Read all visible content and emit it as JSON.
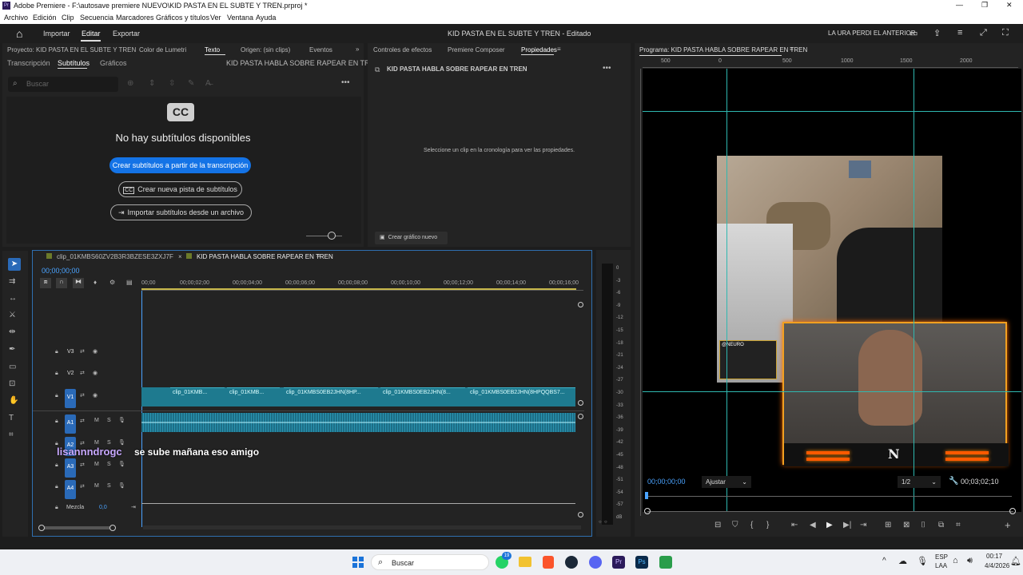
{
  "window": {
    "title": "Adobe Premiere - F:\\autosave premiere NUEVO\\KID PASTA EN EL SUBTE Y TREN.prproj *",
    "minimize": "—",
    "maximize": "❐",
    "close": "✕"
  },
  "menu": [
    "Archivo",
    "Edición",
    "Clip",
    "Secuencia",
    "Marcadores",
    "Gráficos y títulos",
    "Ver",
    "Ventana",
    "Ayuda"
  ],
  "appbar": {
    "home": "⌂",
    "tabs": [
      "Importar",
      "Editar",
      "Exportar"
    ],
    "active_tab": "Editar",
    "center_title": "KID PASTA EN EL SUBTE Y TREN - Editado",
    "right_text": "LA URA PERDI EL ANTERIOR"
  },
  "left_panel": {
    "tabs": [
      "Proyecto: KID PASTA EN EL SUBTE Y TREN",
      "Color de Lumetri",
      "Texto",
      "Origen: (sin clips)",
      "Eventos"
    ],
    "subtabs": [
      "Transcripción",
      "Subtítulos",
      "Gráficos"
    ],
    "sequence_name": "KID PASTA HABLA SOBRE RAPEAR EN TREN",
    "search_placeholder": "Buscar",
    "cc_icon": "CC",
    "no_captions": "No hay subtítulos disponibles",
    "btn_create_from_transcript": "Crear subtítulos a partir de la transcripción",
    "btn_new_track": "Crear nueva pista de subtítulos",
    "btn_import": "Importar subtítulos desde un archivo"
  },
  "mid_panel": {
    "tabs": [
      "Controles de efectos",
      "Premiere Composer",
      "Propiedades"
    ],
    "sequence_name": "KID PASTA HABLA SOBRE RAPEAR EN TREN",
    "hint": "Seleccione un clip en la cronología para ver las propiedades.",
    "create_graphic": "Crear gráfico nuevo"
  },
  "program": {
    "title": "Programa: KID PASTA HABLA SOBRE RAPEAR EN TREN",
    "ruler": [
      "500",
      "0",
      "500",
      "1000",
      "1500",
      "2000"
    ],
    "timecode": "00;00;00;00",
    "fit": "Ajustar",
    "quality": "1/2",
    "duration": "00;03;02;10",
    "overlay_handle": "@NEURO",
    "logo": "N"
  },
  "timeline": {
    "tabs": [
      "clip_01KMBS60ZV2B3R3BZESE3ZXJ7F",
      "KID PASTA HABLA SOBRE RAPEAR EN TREN"
    ],
    "timecode": "00;00;00;00",
    "ruler": [
      "00;00",
      "00;00;02;00",
      "00;00;04;00",
      "00;00;06;00",
      "00;00;08;00",
      "00;00;10;00",
      "00;00;12;00",
      "00;00;14;00",
      "00;00;16;00"
    ],
    "tracks": [
      {
        "name": "V3"
      },
      {
        "name": "V2"
      },
      {
        "name": "V1"
      },
      {
        "name": "A1"
      },
      {
        "name": "A2"
      },
      {
        "name": "A3"
      },
      {
        "name": "A4"
      }
    ],
    "mix_label": "Mezcla",
    "mix_value": "0,0",
    "clips": [
      "clip_01KMB...",
      "clip_01KMB...",
      "clip_01KMBS0EB2JHN(8HP...",
      "clip_01KMBS0EB2JHN(8...",
      "clip_01KMBS0EB2JHN(8HPQQBS7..."
    ],
    "caption_user": "lisannndrogc",
    "caption_text": "se sube mañana eso amigo"
  },
  "meter": {
    "scale": [
      "0",
      "-3",
      "-6",
      "-9",
      "-12",
      "-15",
      "-18",
      "-21",
      "-24",
      "-27",
      "-30",
      "-33",
      "-36",
      "-39",
      "-42",
      "-45",
      "-48",
      "-51",
      "-54",
      "-57",
      "dB"
    ]
  },
  "taskbar": {
    "search": "Buscar",
    "lang1": "ESP",
    "lang2": "LAA",
    "time": "00:17",
    "date": "4/4/2026",
    "badge": "19"
  }
}
